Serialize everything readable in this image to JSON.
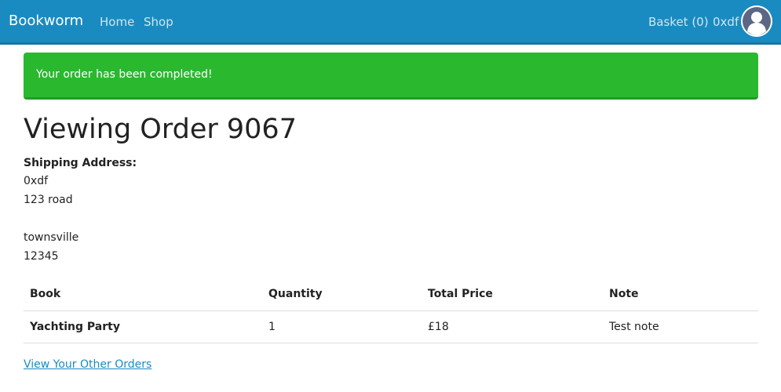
{
  "navbar": {
    "brand": "Bookworm",
    "links": [
      "Home",
      "Shop"
    ],
    "basket": "Basket (0)",
    "username": "0xdf",
    "avatar_icon": "user-avatar-icon"
  },
  "alert": {
    "message": "Your order has been completed!",
    "color": "#2ab82f"
  },
  "order": {
    "title": "Viewing Order 9067",
    "shipping_label": "Shipping Address:",
    "address_lines": [
      "0xdf",
      "123 road",
      "",
      "townsville",
      "12345"
    ]
  },
  "table": {
    "headers": [
      "Book",
      "Quantity",
      "Total Price",
      "Note"
    ],
    "rows": [
      [
        "Yachting Party",
        "1",
        "£18",
        "Test note"
      ]
    ]
  },
  "footer_link": "View Your Other Orders",
  "colors": {
    "navbar": "#1a8bc0",
    "link": "#1a8bc0"
  }
}
